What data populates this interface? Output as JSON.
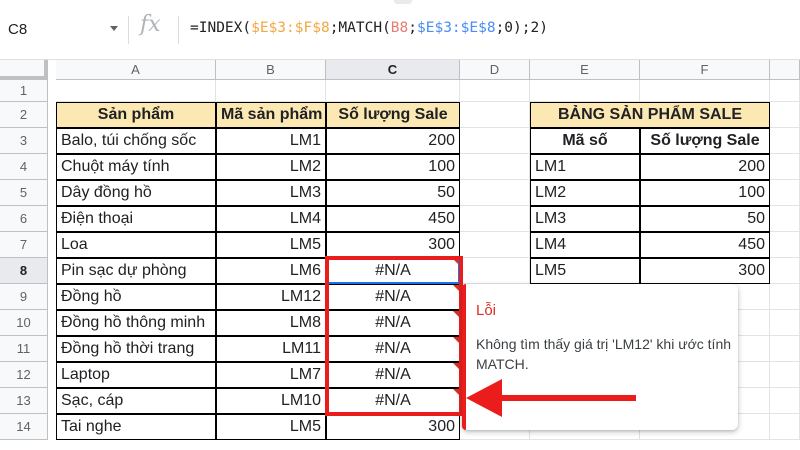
{
  "formula_bar": {
    "cell_ref": "C8",
    "fx_label": "fx",
    "formula": {
      "p1": "=INDEX(",
      "r1": "$E$3:$F$8",
      "p2": ";MATCH(",
      "r2": "B8",
      "p3": ";",
      "r3": "$E$3:$E$8",
      "p4": ";0);2)"
    }
  },
  "columns": [
    "A",
    "B",
    "C",
    "D",
    "E",
    "F"
  ],
  "rows": [
    "1",
    "2",
    "3",
    "4",
    "5",
    "6",
    "7",
    "8",
    "9",
    "10",
    "11",
    "12",
    "13",
    "14"
  ],
  "main_table": {
    "headers": [
      "Sản phẩm",
      "Mã sản phẩm",
      "Số lượng Sale"
    ],
    "rows": [
      [
        "Balo, túi chống sốc",
        "LM1",
        "200"
      ],
      [
        "Chuột máy tính",
        "LM2",
        "100"
      ],
      [
        "Dây đồng hồ",
        "LM3",
        "50"
      ],
      [
        "Điện thoại",
        "LM4",
        "450"
      ],
      [
        "Loa",
        "LM5",
        "300"
      ],
      [
        "Pin sạc dự phòng",
        "LM6",
        "#N/A"
      ],
      [
        "Đồng hồ",
        "LM12",
        "#N/A"
      ],
      [
        "Đồng hồ thông minh",
        "LM8",
        "#N/A"
      ],
      [
        "Đồng hồ thời trang",
        "LM11",
        "#N/A"
      ],
      [
        "Laptop",
        "LM7",
        "#N/A"
      ],
      [
        "Sạc, cáp",
        "LM10",
        "#N/A"
      ],
      [
        "Tai nghe",
        "LM5",
        "300"
      ]
    ]
  },
  "sale_table": {
    "title": "BẢNG SẢN PHẨM SALE",
    "headers": [
      "Mã số",
      "Số lượng Sale"
    ],
    "rows": [
      [
        "LM1",
        "200"
      ],
      [
        "LM2",
        "100"
      ],
      [
        "LM3",
        "50"
      ],
      [
        "LM4",
        "450"
      ],
      [
        "LM5",
        "300"
      ]
    ]
  },
  "error_tooltip": {
    "title": "Lỗi",
    "message": "Không tìm thấy giá trị 'LM12' khi ước tính MATCH."
  },
  "colors": {
    "header_fill": "#fce8b2",
    "selection": "#1a73e8",
    "highlight": "#ea1c1c"
  }
}
